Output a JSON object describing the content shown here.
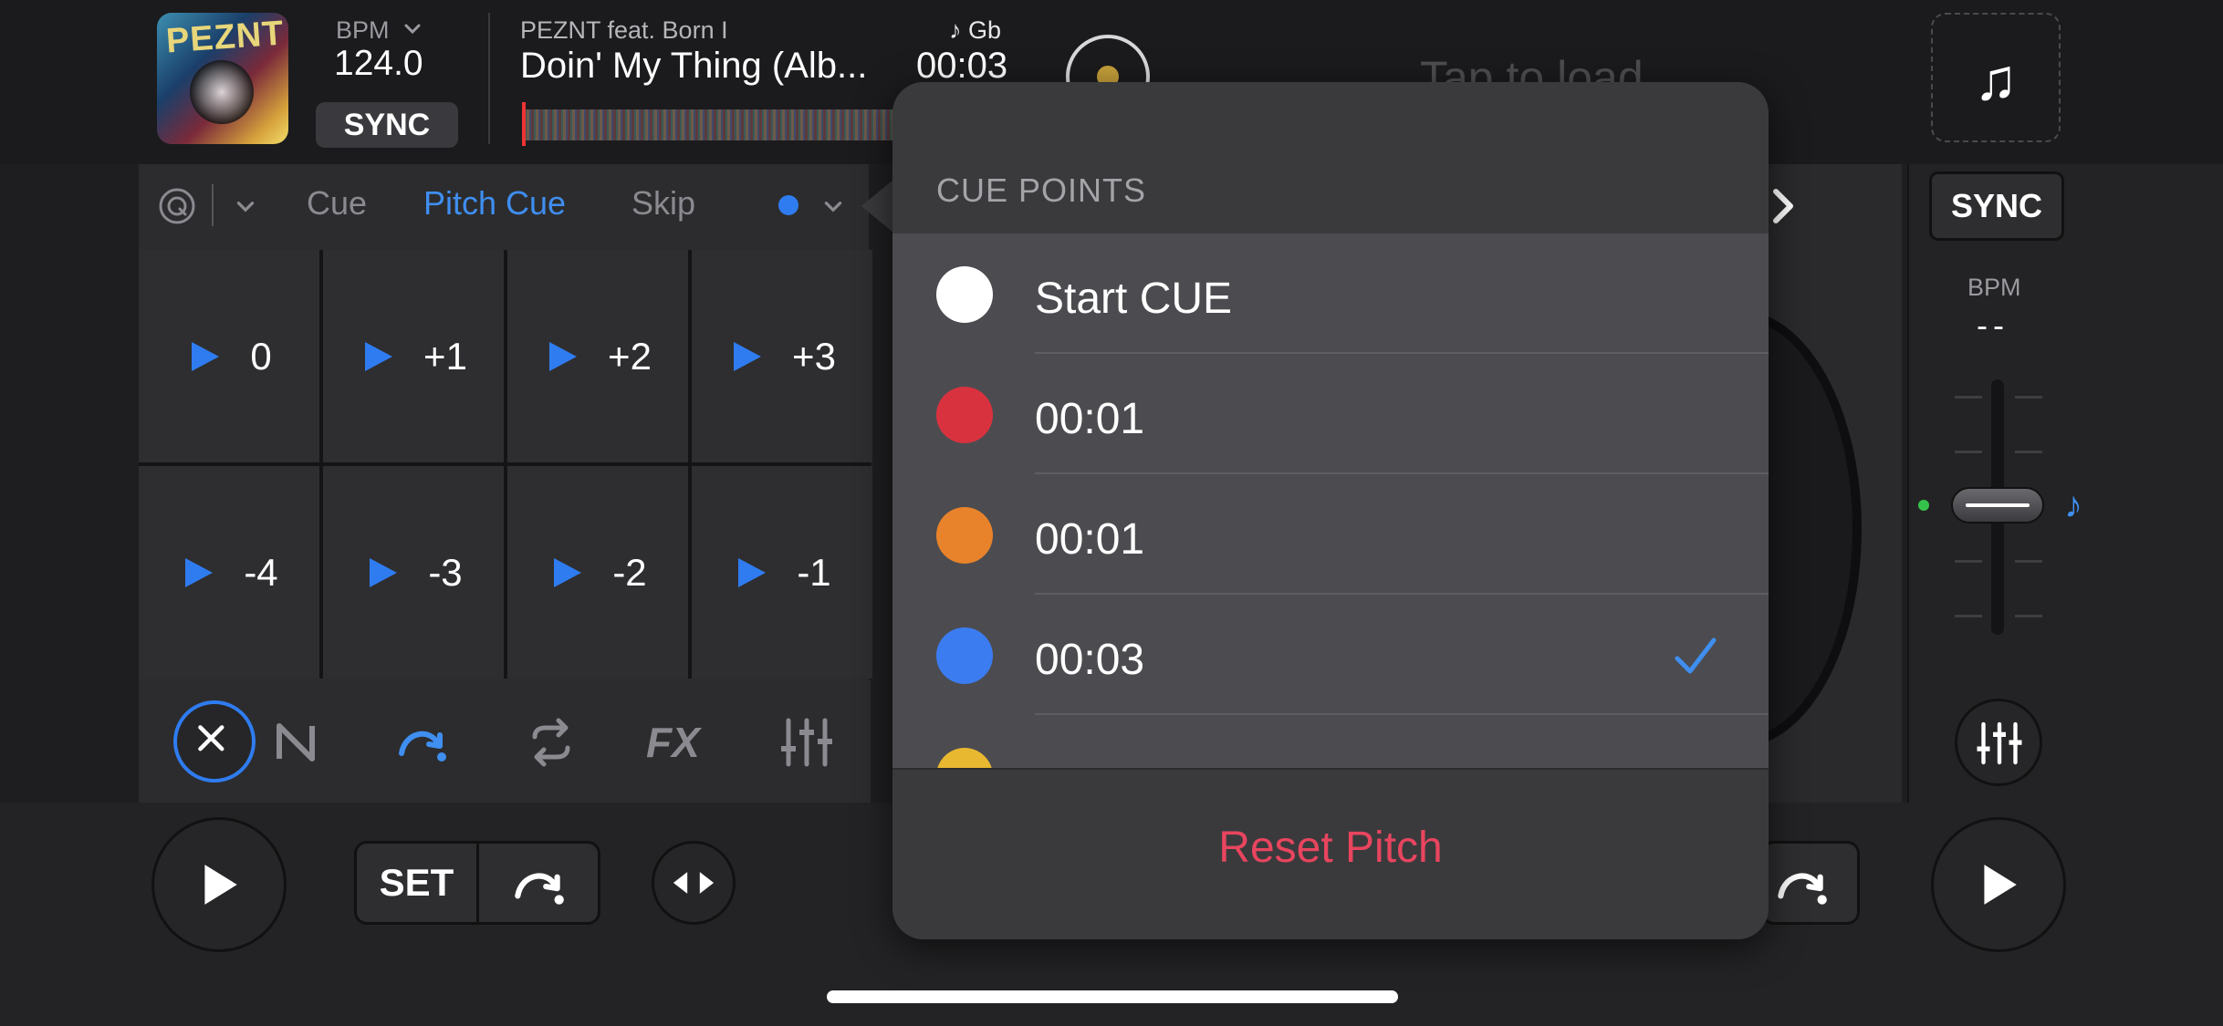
{
  "top_bar": {
    "cover_text": "PEZNT",
    "bpm_label": "BPM",
    "bpm_value": "124.0",
    "sync_label": "SYNC",
    "artist": "PEZNT feat. Born I",
    "key": "♪ Gb",
    "title": "Doin' My Thing (Alb...",
    "time": "00:03",
    "tap_to_load": "Tap to load",
    "music_icon": "♫"
  },
  "mode_bar": {
    "tabs": [
      {
        "label": "Cue",
        "active": false
      },
      {
        "label": "Pitch Cue",
        "active": true
      },
      {
        "label": "Skip",
        "active": false
      }
    ]
  },
  "pads": {
    "row1": [
      "0",
      "+1",
      "+2",
      "+3"
    ],
    "row2": [
      "-4",
      "-3",
      "-2",
      "-1"
    ]
  },
  "transport": {
    "set_label": "SET"
  },
  "right_deck": {
    "sync_label": "SYNC",
    "bpm_label": "BPM",
    "bpm_value": "--"
  },
  "popover": {
    "title": "CUE POINTS",
    "items": [
      {
        "label": "Start CUE",
        "color": "#ffffff",
        "selected": false
      },
      {
        "label": "00:01",
        "color": "#d9323f",
        "selected": false
      },
      {
        "label": "00:01",
        "color": "#e8832b",
        "selected": false
      },
      {
        "label": "00:03",
        "color": "#3b7cf0",
        "selected": true
      },
      {
        "label": "",
        "color": "#e8b830",
        "selected": false
      }
    ],
    "reset_label": "Reset Pitch"
  },
  "colors": {
    "accent_blue": "#3f8ef0",
    "reset_red": "#e8455e"
  }
}
